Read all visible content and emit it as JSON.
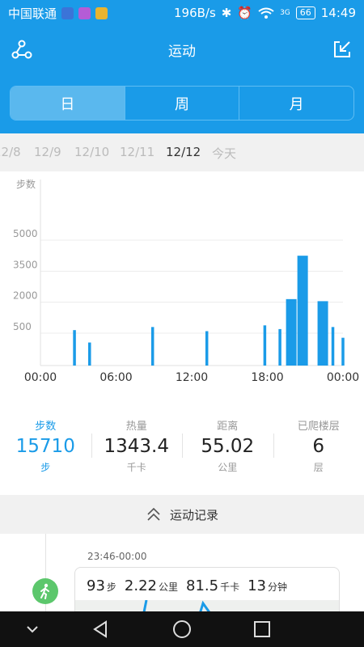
{
  "status_bar": {
    "carrier": "中国联通",
    "net_speed": "196B/s",
    "network": "3G",
    "battery": "66",
    "time": "14:49"
  },
  "header": {
    "title": "运动",
    "tabs": [
      {
        "label": "日",
        "active": true
      },
      {
        "label": "周",
        "active": false
      },
      {
        "label": "月",
        "active": false
      }
    ]
  },
  "dates": [
    {
      "label": "12/8",
      "active": false
    },
    {
      "label": "12/9",
      "active": false
    },
    {
      "label": "12/10",
      "active": false
    },
    {
      "label": "12/11",
      "active": false
    },
    {
      "label": "12/12",
      "active": true
    },
    {
      "label": "今天",
      "active": false
    }
  ],
  "chart_data": {
    "type": "bar",
    "ylabel": "步数",
    "y_ticks": [
      "5000",
      "3500",
      "2000",
      "500"
    ],
    "x_ticks": [
      "00:00",
      "06:00",
      "12:00",
      "18:00",
      "00:00"
    ],
    "x_range_hours": [
      0,
      24
    ],
    "bar_color": "#1a9be8",
    "bars": [
      {
        "x": 2.7,
        "y": 650
      },
      {
        "x": 3.9,
        "y": 50
      },
      {
        "x": 8.9,
        "y": 800
      },
      {
        "x": 13.2,
        "y": 600
      },
      {
        "x": 17.8,
        "y": 880
      },
      {
        "x": 19.0,
        "y": 700
      },
      {
        "x": 19.9,
        "y": 2150
      },
      {
        "x": 20.8,
        "y": 4250
      },
      {
        "x": 22.4,
        "y": 2050
      },
      {
        "x": 23.2,
        "y": 800
      },
      {
        "x": 24.0,
        "y": 280
      }
    ]
  },
  "stats": [
    {
      "label": "步数",
      "value": "15710",
      "unit": "步",
      "active": true
    },
    {
      "label": "热量",
      "value": "1343.4",
      "unit": "千卡",
      "active": false
    },
    {
      "label": "距离",
      "value": "55.02",
      "unit": "公里",
      "active": false
    },
    {
      "label": "已爬楼层",
      "value": "6",
      "unit": "层",
      "active": false
    }
  ],
  "records": {
    "title": "运动记录",
    "items": [
      {
        "time": "23:46-00:00",
        "steps": "93",
        "steps_unit": "步",
        "distance": "2.22",
        "distance_unit": "公里",
        "calories": "81.5",
        "calories_unit": "千卡",
        "duration": "13",
        "duration_unit": "分钟"
      }
    ]
  },
  "icons": {
    "share": "share-icon",
    "export": "export-icon",
    "walk": "walk-icon",
    "collapse": "chevron-double-up-icon"
  }
}
